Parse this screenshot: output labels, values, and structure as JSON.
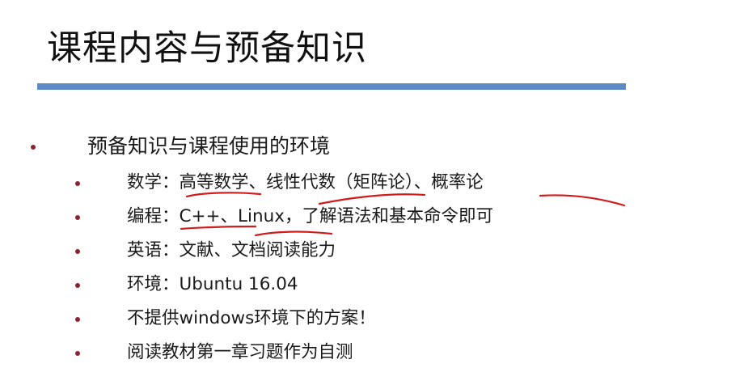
{
  "slide": {
    "title": "课程内容与预备知识",
    "accent_color": "#5b8ac6",
    "bullet_color": "#8a2430",
    "annotation_color": "#d11c1c",
    "main_bullet": "预备知识与课程使用的环境",
    "sub_bullets": [
      "数学：高等数学、线性代数（矩阵论）、概率论",
      "编程：C++、Linux，了解语法和基本命令即可",
      "英语：文献、文档阅读能力",
      "环境：Ubuntu 16.04",
      "不提供windows环境下的方案！",
      "阅读教材第一章习题作为自测"
    ]
  }
}
